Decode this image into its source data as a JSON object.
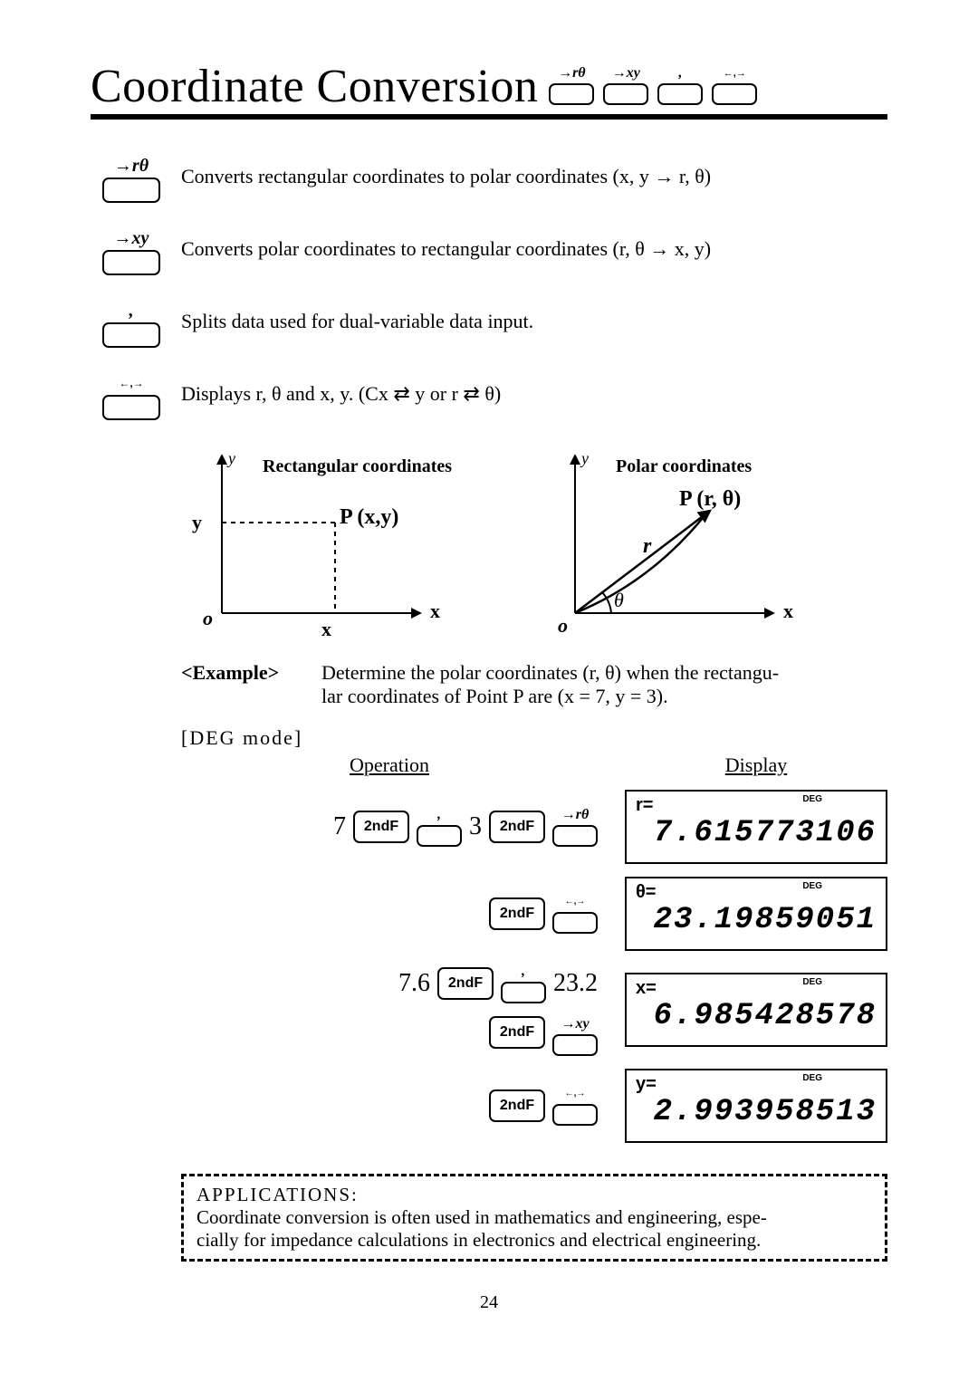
{
  "title": "Coordinate Conversion",
  "title_keys": {
    "rtheta": "→rθ",
    "xy": "→xy",
    "comma": ",",
    "swap": "←,→"
  },
  "defs": {
    "rtheta": "Converts rectangular coordinates to polar coordinates (x, y → r, θ)",
    "xy": "Converts polar coordinates to rectangular coordinates (r, θ → x, y)",
    "comma": "Splits data used for dual-variable data input.",
    "swap": "Displays r, θ and x, y. (Cx ⇄ y or r ⇄ θ)"
  },
  "diagram": {
    "rect_title": "Rectangular coordinates",
    "polar_title": "Polar coordinates",
    "P_rect": "P (x,y)",
    "P_polar": "P (r, θ)",
    "y_axis": "y",
    "x_axis": "x",
    "origin": "o",
    "y_label_bold": "y",
    "x_label_bold": "x",
    "r_label": "r",
    "theta_label": "θ"
  },
  "example": {
    "label": "<Example>",
    "text_1": "Determine the polar coordinates (r, θ) when the rectangu-",
    "text_2": "lar coordinates of Point P are (x = 7, y = 3).",
    "mode": "[DEG mode]"
  },
  "table": {
    "header_op": "Operation",
    "header_disp": "Display",
    "k_2ndf": "2ndF",
    "rows": [
      {
        "op_pre": "7",
        "op_mid": "3",
        "lcd_label": "r=",
        "lcd_val": "7.615773106"
      },
      {
        "lcd_label": "θ=",
        "lcd_val": "23.19859051"
      },
      {
        "op_pre": "7.6",
        "op_mid": "23.2",
        "lcd_label": "x=",
        "lcd_val": "6.985428578"
      },
      {
        "lcd_label": "y=",
        "lcd_val": "2.993958513"
      }
    ],
    "deg_indicator": "DEG"
  },
  "applications": {
    "title": "APPLICATIONS:",
    "body_1": "Coordinate conversion is often used in mathematics and engineering, espe-",
    "body_2": "cially for impedance calculations in electronics and electrical engineering."
  },
  "page_number": "24"
}
